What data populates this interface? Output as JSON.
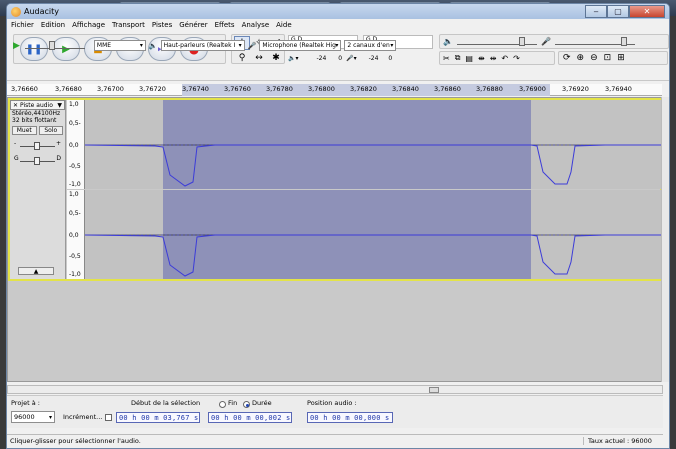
{
  "window": {
    "title": "Audacity",
    "controls": {
      "minimize": "‒",
      "maximize": "▢",
      "close": "✕"
    }
  },
  "menu": [
    "Fichier",
    "Edition",
    "Affichage",
    "Transport",
    "Pistes",
    "Générer",
    "Effets",
    "Analyse",
    "Aide"
  ],
  "transport": {
    "pause": "❚❚",
    "play": "▶",
    "stop": "■",
    "skip_start": "⏮",
    "skip_end": "⏭",
    "record": "●"
  },
  "tools": [
    "I",
    "✧",
    "𝒻",
    "⚲",
    "↔",
    "✱"
  ],
  "meters": {
    "output_label": "G D",
    "input_label": "G D",
    "ticks_left": [
      "-24",
      "0"
    ],
    "ticks_right": [
      "-24",
      "0"
    ]
  },
  "devices": {
    "host": "MME",
    "output": "Haut-parleurs (Realtek I",
    "input": "Microphone (Realtek Hig",
    "channels": "2 canaux d'en"
  },
  "ruler": {
    "labels": [
      "3,76660",
      "3,76680",
      "3,76700",
      "3,76720",
      "3,76740",
      "3,76760",
      "3,76780",
      "3,76800",
      "3,76820",
      "3,76840",
      "3,76860",
      "3,76880",
      "3,76900",
      "3,76920",
      "3,76940"
    ]
  },
  "track": {
    "name": "Piste audio",
    "rate": "Stéréo,44100Hz",
    "format": "32 bits flottant",
    "mute": "Muet",
    "solo": "Solo",
    "gain_minus": "-",
    "gain_plus": "+",
    "pan_left": "G",
    "pan_right": "D",
    "collapse": "▲",
    "scale": [
      "1,0",
      "0,5-",
      "0,0",
      "-0,5",
      "-1,0"
    ]
  },
  "selection_toolbar": {
    "project_rate_label": "Projet à :",
    "project_rate": "96000",
    "snap_label": "Incrément...",
    "start_label": "Début de la sélection",
    "end_radio": "Fin",
    "duration_radio": "Durée",
    "audio_position_label": "Position audio :",
    "start_value": "00 h 00 m 03,767 s",
    "duration_value": "00 h 00 m 00,002 s",
    "position_value": "00 h 00 m 00,000 s"
  },
  "status": {
    "hint": "Cliquer-glisser pour sélectionner l'audio.",
    "rate": "Taux actuel : 96000"
  },
  "colors": {
    "selection": "#8e91b8",
    "waveform": "#3c3cd8",
    "track_border": "#e3e348"
  }
}
